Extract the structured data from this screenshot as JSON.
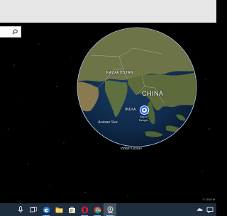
{
  "window": {
    "title": ""
  },
  "search": {
    "placeholder": "",
    "value": ""
  },
  "globe": {
    "labels": {
      "kazakhstan": "KAZAKHSTAN",
      "china": "CHINA",
      "india": "INDIA",
      "arabian_sea": "Arabian Sea",
      "bay_of_bengal_1": "Bay of",
      "bay_of_bengal_2": "Bengal",
      "indian_ocean": "Indian Ocean"
    },
    "pin_location": "Bay of Bengal"
  },
  "copyright": "© 2019 M",
  "taskbar": {
    "items": [
      {
        "name": "microphone-icon"
      },
      {
        "name": "task-view-icon"
      },
      {
        "name": "edge-icon"
      },
      {
        "name": "file-explorer-icon"
      },
      {
        "name": "store-icon"
      },
      {
        "name": "opera-icon"
      },
      {
        "name": "chrome-icon"
      },
      {
        "name": "maps-app-icon"
      }
    ],
    "tray": [
      "onedrive-icon",
      "chat-icon"
    ]
  },
  "colors": {
    "titlebar": "#e6e6e6",
    "space": "#000000",
    "taskbar": "#1f2e3f",
    "pin": "#1b5cff",
    "ocean": "#0f2a4a",
    "land": "#5a6a3f"
  }
}
